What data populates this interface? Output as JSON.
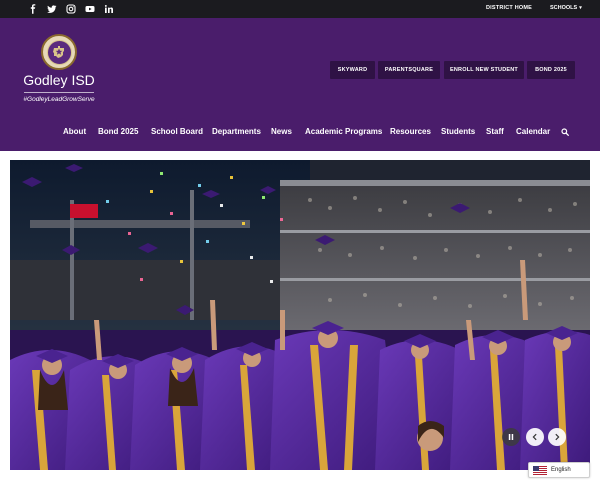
{
  "topbar": {
    "social": [
      "facebook-icon",
      "x-twitter-icon",
      "instagram-icon",
      "youtube-icon",
      "linkedin-icon"
    ],
    "district_home": "DISTRICT HOME",
    "schools": "SCHOOLS"
  },
  "header": {
    "site_name": "Godley ISD",
    "motto": "#GodleyLeadGrowServe",
    "quick_links": [
      "SKYWARD",
      "PARENTSQUARE",
      "ENROLL NEW STUDENT",
      "BOND 2025"
    ]
  },
  "nav": {
    "items": [
      "About",
      "Bond 2025",
      "School Board",
      "Departments",
      "News",
      "Academic Programs",
      "Resources",
      "Students",
      "Staff",
      "Calendar"
    ]
  },
  "language": {
    "label": "English"
  },
  "colors": {
    "brand_purple": "#4a1d6b",
    "dark_bar": "#1b1b1f",
    "button_purple": "#2f1245",
    "gold": "#d9a53a"
  }
}
